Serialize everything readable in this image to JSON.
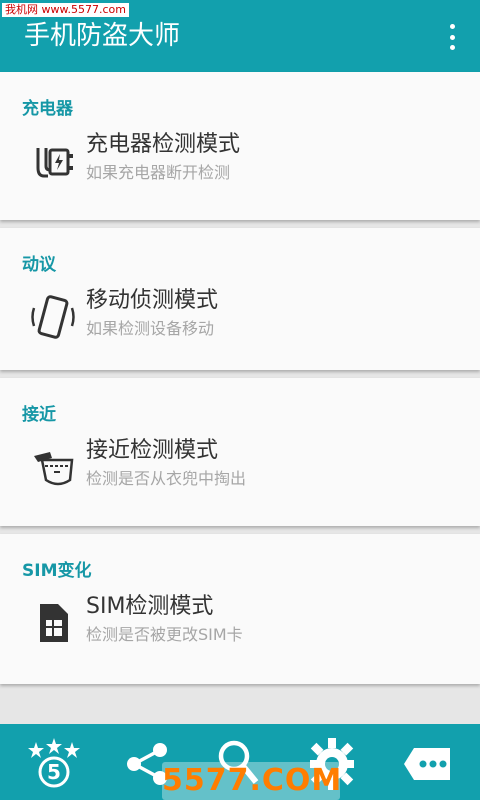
{
  "watermark_top": "我机网 www.5577.com",
  "header": {
    "title": "手机防盗大师",
    "menu_icon": "overflow-menu-icon"
  },
  "sections": [
    {
      "heading": "充电器",
      "title": "充电器检测模式",
      "subtitle": "如果充电器断开检测",
      "icon": "charger-icon"
    },
    {
      "heading": "动议",
      "title": "移动侦测模式",
      "subtitle": "如果检测设备移动",
      "icon": "phone-motion-icon"
    },
    {
      "heading": "接近",
      "title": "接近检测模式",
      "subtitle": "检测是否从衣兜中掏出",
      "icon": "pocket-icon"
    },
    {
      "heading": "SIM变化",
      "title": "SIM检测模式",
      "subtitle": "检测是否被更改SIM卡",
      "icon": "sim-card-icon"
    }
  ],
  "bottom_bar": {
    "icons": [
      "rate-stars-icon",
      "share-icon",
      "search-icon",
      "settings-icon",
      "more-icon"
    ],
    "rate_badge": "5"
  },
  "watermark_bottom": "5577.COM",
  "colors": {
    "primary": "#12a0ad",
    "section_heading": "#1697a6",
    "card": "#fafafa",
    "background": "#e6e6e6",
    "title_text": "#333333",
    "subtitle_text": "#a6a6a6"
  }
}
